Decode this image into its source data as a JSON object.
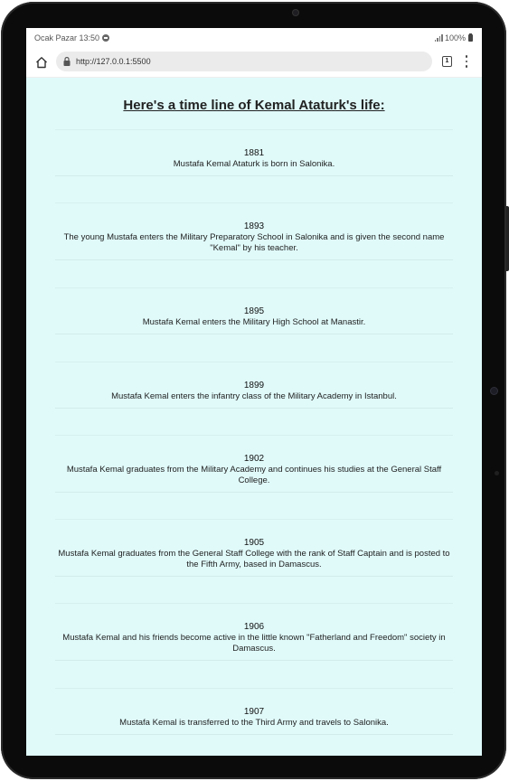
{
  "status_bar": {
    "left_text": "Ocak Pazar 13:50",
    "battery_text": "100%"
  },
  "browser": {
    "url": "http://127.0.0.1:5500",
    "tab_count": "1"
  },
  "page": {
    "title": "Here's a time line of Kemal Ataturk's life:",
    "events": [
      {
        "year": "1881",
        "text": "Mustafa Kemal Ataturk is born in Salonika."
      },
      {
        "year": "1893",
        "text": "The young Mustafa enters the Military Preparatory School in Salonika and is given the second name \"Kemal\" by his teacher."
      },
      {
        "year": "1895",
        "text": "Mustafa Kemal enters the Military High School at Manastir."
      },
      {
        "year": "1899",
        "text": "Mustafa Kemal enters the infantry class of the Military Academy in Istanbul."
      },
      {
        "year": "1902",
        "text": "Mustafa Kemal graduates from the Military Academy and continues his studies at the General Staff College."
      },
      {
        "year": "1905",
        "text": "Mustafa Kemal graduates from the General Staff College with the rank of Staff Captain and is posted to the Fifth Army, based in Damascus."
      },
      {
        "year": "1906",
        "text": "Mustafa Kemal and his friends become active in the little known \"Fatherland and Freedom\" society in Damascus."
      },
      {
        "year": "1907",
        "text": "Mustafa Kemal is transferred to the Third Army and travels to Salonika."
      }
    ]
  }
}
